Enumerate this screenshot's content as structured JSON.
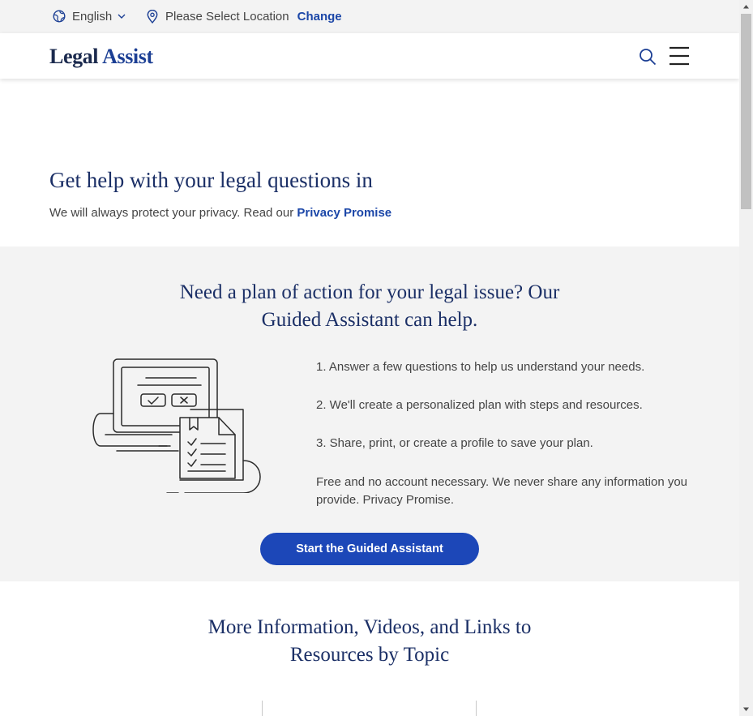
{
  "utility_bar": {
    "language": "English",
    "location_prompt": "Please Select Location",
    "change_label": "Change"
  },
  "header": {
    "logo_part1": "Legal",
    "logo_part2": "Assist",
    "search_icon": "search-icon",
    "menu_icon": "hamburger-menu-icon"
  },
  "hero": {
    "title": "Get help with your legal questions in",
    "subtitle": "We will always protect your privacy. Read our",
    "privacy_link": "Privacy Promise"
  },
  "guided": {
    "title_line1": "Need a plan of action for your legal issue? Our",
    "title_line2": "Guided Assistant can help.",
    "steps": [
      "1. Answer a few questions to help us understand your needs.",
      "2. We'll create a personalized plan with steps and resources.",
      "3. Share, print, or create a profile to save your plan."
    ],
    "note": "Free and no account necessary. We never share any information you provide. Privacy Promise.",
    "cta_label": "Start the Guided Assistant"
  },
  "more_info": {
    "title_line1": "More Information, Videos, and Links to",
    "title_line2": "Resources by Topic"
  },
  "colors": {
    "brand_navy": "#1b2f66",
    "link_blue": "#1c47a8",
    "button_blue": "#1c47b8",
    "band_gray": "#f3f3f3"
  }
}
